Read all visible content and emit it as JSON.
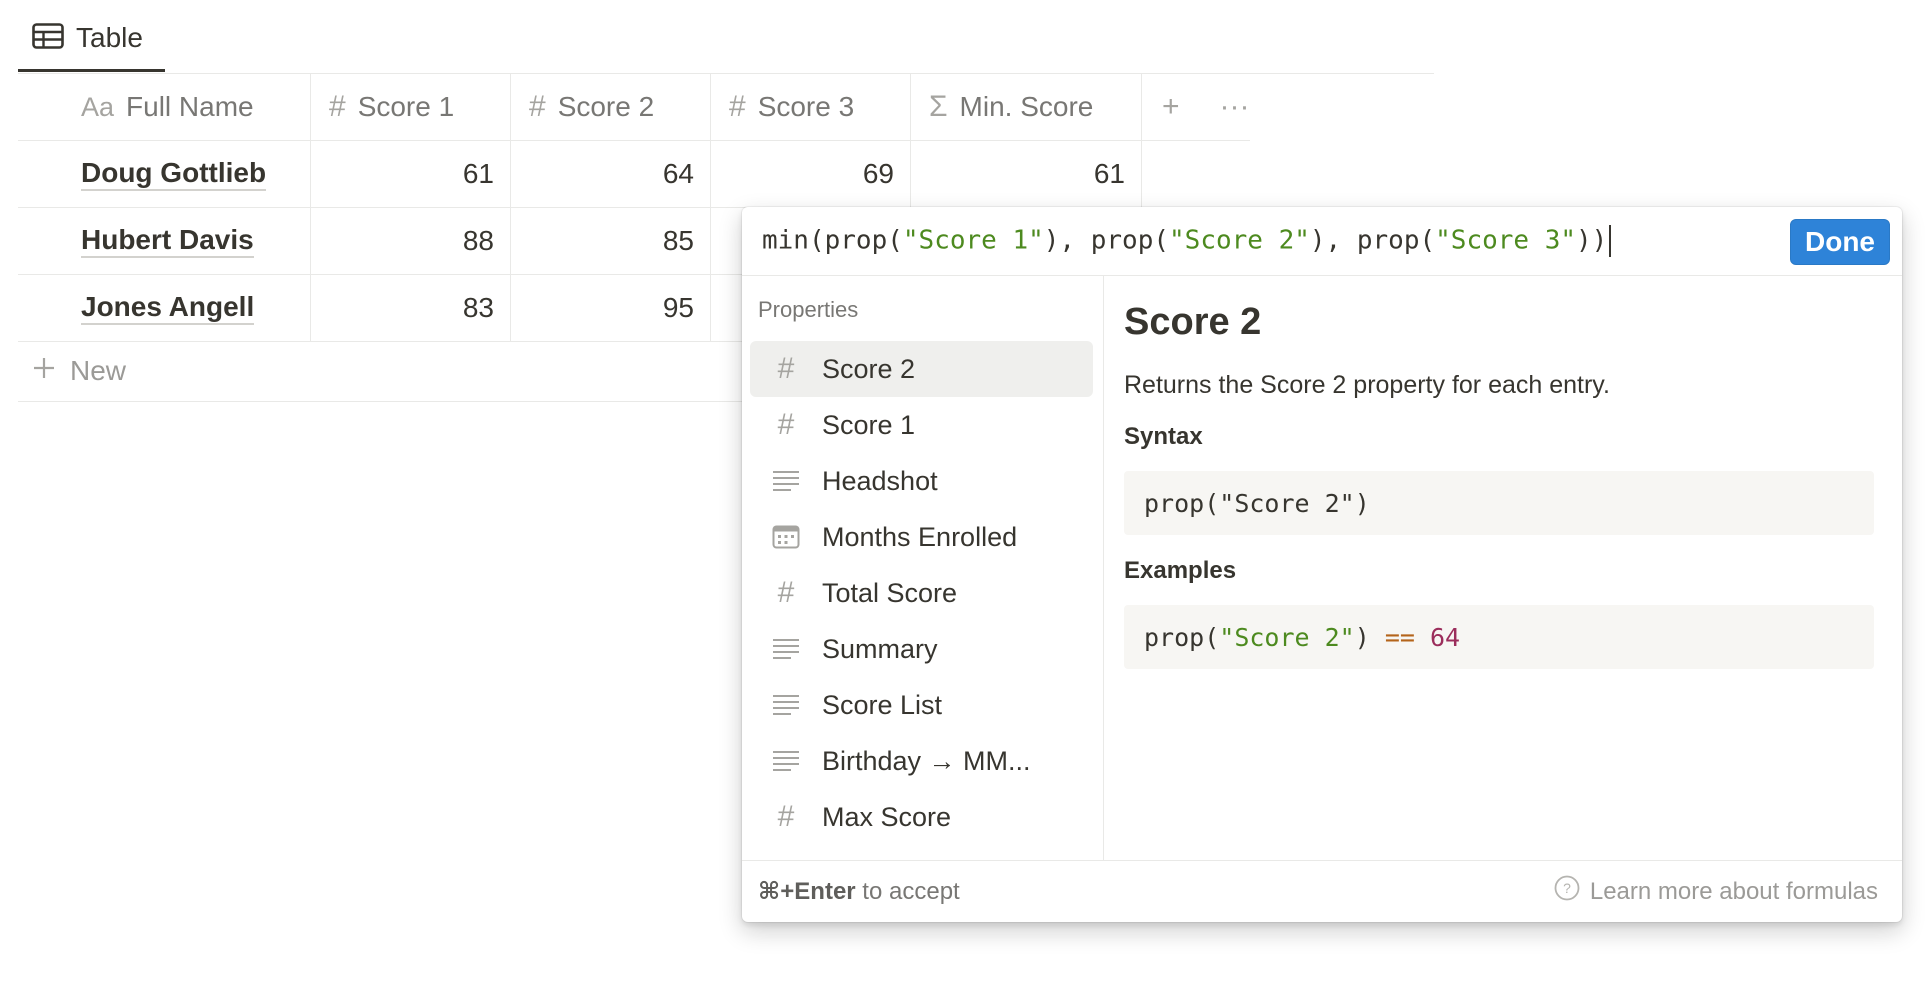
{
  "view_tab": {
    "label": "Table",
    "icon": "table-icon"
  },
  "table": {
    "columns": [
      {
        "icon": "Aa",
        "label": "Full Name"
      },
      {
        "icon": "#",
        "label": "Score 1"
      },
      {
        "icon": "#",
        "label": "Score 2"
      },
      {
        "icon": "#",
        "label": "Score 3"
      },
      {
        "icon": "Σ",
        "label": "Min. Score"
      }
    ],
    "rows": [
      {
        "name": "Doug Gottlieb",
        "score1": "61",
        "score2": "64",
        "score3": "69",
        "min": "61"
      },
      {
        "name": "Hubert Davis",
        "score1": "88",
        "score2": "85",
        "score3": "",
        "min": ""
      },
      {
        "name": "Jones Angell",
        "score1": "83",
        "score2": "95",
        "score3": "",
        "min": ""
      }
    ],
    "add_column_icon": "+",
    "more_icon": "···",
    "new_row_label": "New"
  },
  "formula": {
    "prefix1": "min(prop(",
    "arg1": "\"Score 1\"",
    "mid1": "), prop(",
    "arg2": "\"Score 2\"",
    "mid2": "), prop(",
    "arg3": "\"Score 3\"",
    "suffix": "))",
    "done_label": "Done"
  },
  "properties": {
    "heading": "Properties",
    "items": [
      {
        "icon": "#",
        "label": "Score 2"
      },
      {
        "icon": "#",
        "label": "Score 1"
      },
      {
        "icon": "≡",
        "label": "Headshot"
      },
      {
        "icon": "cal",
        "label": "Months Enrolled"
      },
      {
        "icon": "#",
        "label": "Total Score"
      },
      {
        "icon": "≡",
        "label": "Summary"
      },
      {
        "icon": "≡",
        "label": "Score List"
      },
      {
        "icon": "≡",
        "label": "Birthday → MM..."
      },
      {
        "icon": "#",
        "label": "Max Score"
      }
    ]
  },
  "detail": {
    "title": "Score 2",
    "description": "Returns the Score 2 property for each entry.",
    "syntax_heading": "Syntax",
    "syntax_code_fn": "prop(",
    "syntax_code_arg": "\"Score 2\"",
    "syntax_code_end": ")",
    "examples_heading": "Examples",
    "example_fn": "prop(",
    "example_arg": "\"Score 2\"",
    "example_end": ") ",
    "example_op": "==",
    "example_num": " 64"
  },
  "footer": {
    "shortcut": "⌘+Enter",
    "shortcut_suffix": " to accept",
    "learn_more": "Learn more about formulas"
  }
}
